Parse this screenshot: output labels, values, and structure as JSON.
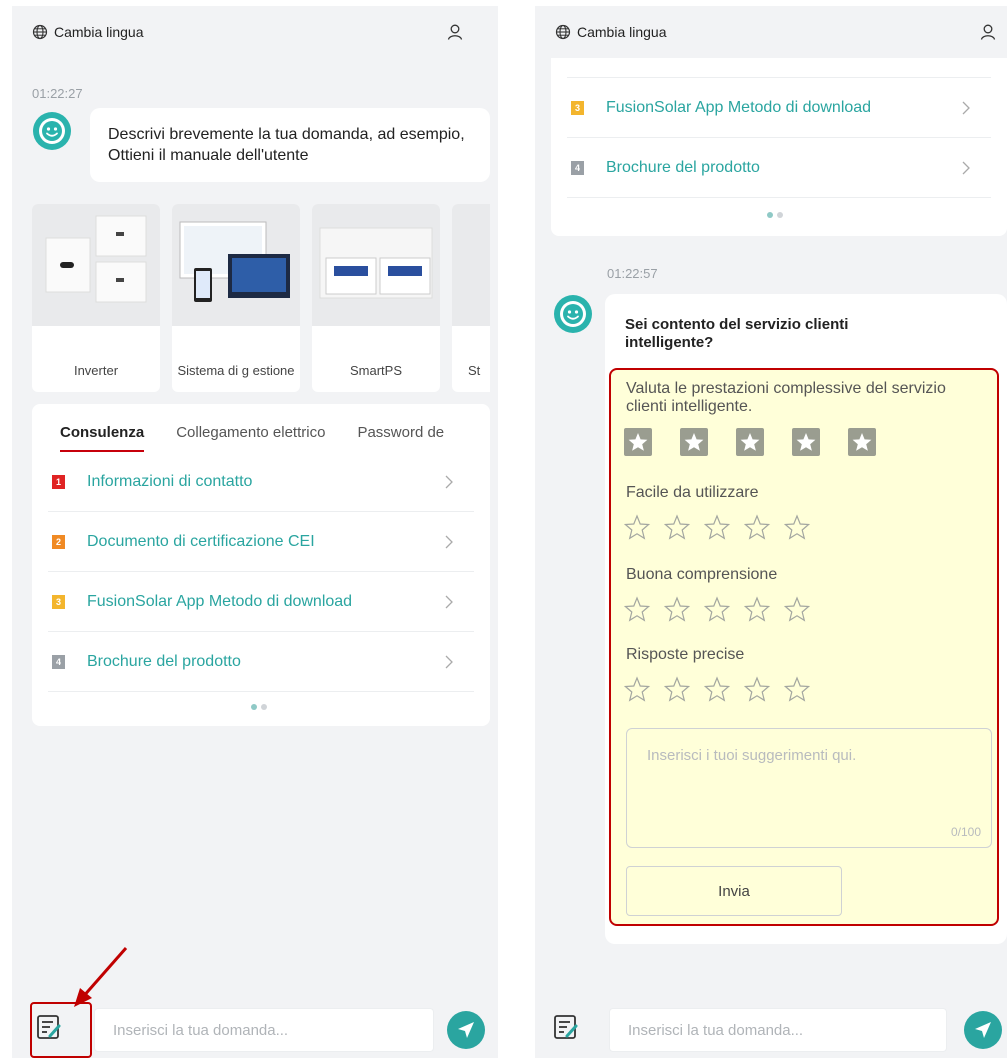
{
  "colors": {
    "accent_teal": "#2aa5a0",
    "tab_underline": "#c7000b",
    "highlight_red": "#c00000",
    "highlight_fill": "#ffffd9",
    "num_red": "#e02424",
    "num_orange": "#f08a24",
    "num_yellow": "#f3b52d",
    "num_gray": "#9aa0a6"
  },
  "header": {
    "language_label": "Cambia lingua",
    "globe_icon": "globe-icon",
    "user_icon": "user-icon"
  },
  "left": {
    "timestamp": "01:22:27",
    "greeting": "Descrivi brevemente la tua domanda, ad esempio, Ottieni il manuale dell'utente",
    "products": [
      {
        "label": "Inverter"
      },
      {
        "label": "Sistema di g estione"
      },
      {
        "label": "SmartPS"
      },
      {
        "label": "St"
      }
    ],
    "tabs": [
      "Consulenza",
      "Collegamento elettrico",
      "Password de"
    ],
    "faq": [
      {
        "num": "1",
        "text": "Informazioni di contatto"
      },
      {
        "num": "2",
        "text": "Documento di certificazione CEI"
      },
      {
        "num": "3",
        "text": "FusionSolar App Metodo di download"
      },
      {
        "num": "4",
        "text": "Brochure del prodotto"
      }
    ]
  },
  "right": {
    "faq": [
      {
        "num": "3",
        "text": "FusionSolar App Metodo di download"
      },
      {
        "num": "4",
        "text": "Brochure del prodotto"
      }
    ],
    "timestamp": "01:22:57",
    "survey": {
      "title": "Sei contento del servizio clienti intelligente?",
      "overall_label": "Valuta le prestazioni complessive del servizio clienti intelligente.",
      "questions": [
        "Facile da utilizzare",
        "Buona comprensione",
        "Risposte precise"
      ],
      "suggestion_placeholder": "Inserisci i tuoi suggerimenti qui.",
      "counter": "0/100",
      "submit_label": "Invia"
    }
  },
  "input": {
    "placeholder": "Inserisci la tua domanda..."
  }
}
